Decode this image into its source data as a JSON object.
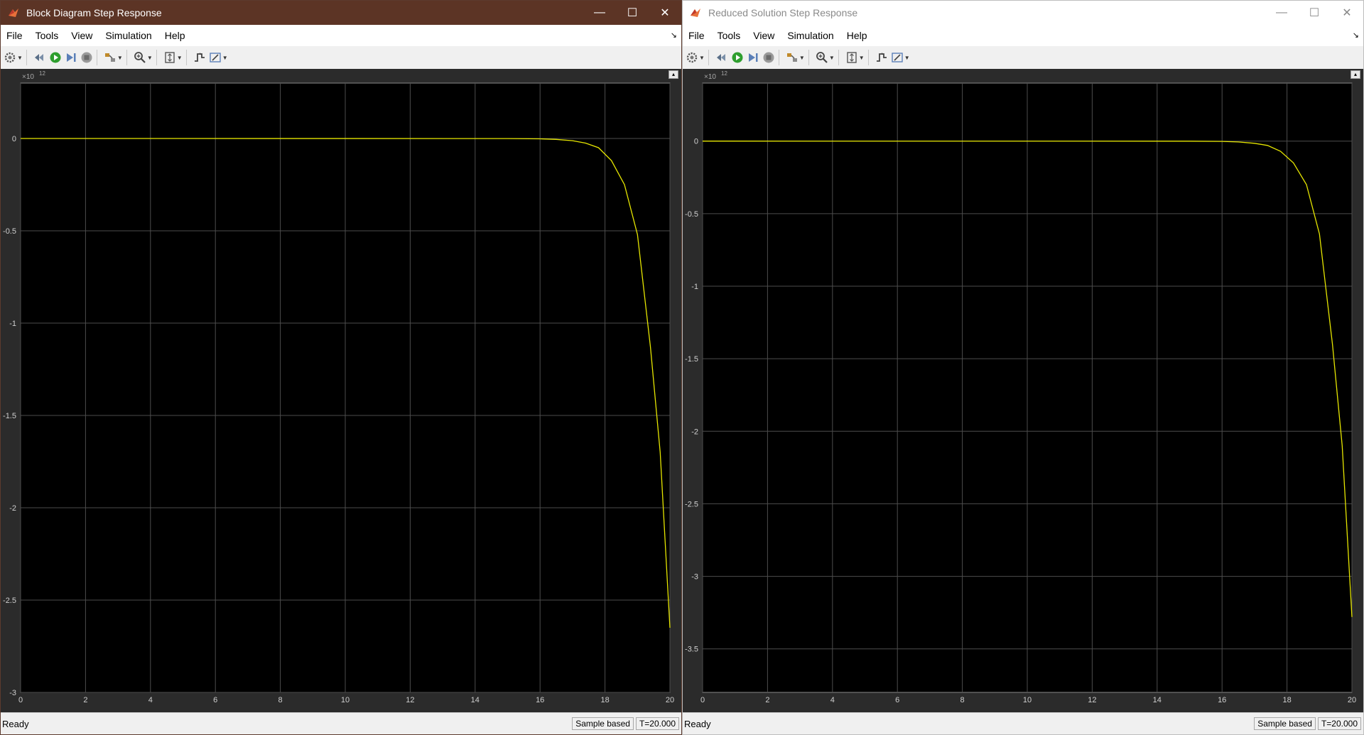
{
  "windows": [
    {
      "title": "Block Diagram Step Response",
      "active": true,
      "menu": [
        "File",
        "Tools",
        "View",
        "Simulation",
        "Help"
      ],
      "status": "Ready",
      "sample_mode": "Sample based",
      "time": "T=20.000",
      "exponent_label": "×10",
      "exponent_power": "12"
    },
    {
      "title": "Reduced Solution Step Response",
      "active": false,
      "menu": [
        "File",
        "Tools",
        "View",
        "Simulation",
        "Help"
      ],
      "status": "Ready",
      "sample_mode": "Sample based",
      "time": "T=20.000",
      "exponent_label": "×10",
      "exponent_power": "12"
    }
  ],
  "toolbar_icons": [
    "settings-icon",
    "restore-icon",
    "run-icon",
    "step-forward-icon",
    "stop-icon",
    "highlight-icon",
    "zoom-icon",
    "scale-axes-icon",
    "triggers-icon",
    "cursor-measurements-icon"
  ],
  "colors": {
    "active_titlebar": "#5c3425",
    "plot_background": "#000000",
    "trace": "#e6e600",
    "grid": "#4d4d4d"
  },
  "chart_data": [
    {
      "type": "line",
      "title": "",
      "xlabel": "",
      "ylabel": "",
      "exponent": "×10^12",
      "xlim": [
        0,
        20
      ],
      "ylim": [
        -3,
        0.3
      ],
      "xticks": [
        0,
        2,
        4,
        6,
        8,
        10,
        12,
        14,
        16,
        18,
        20
      ],
      "yticks": [
        0,
        -0.5,
        -1,
        -1.5,
        -2,
        -2.5,
        -3
      ],
      "ytick_labels": [
        "0",
        "-0.5",
        "-1",
        "-1.5",
        "-2",
        "-2.5",
        "-3"
      ],
      "grid": true,
      "series": [
        {
          "x": [
            0,
            15,
            16,
            16.5,
            17,
            17.4,
            17.8,
            18.2,
            18.6,
            19.0,
            19.4,
            19.7,
            20
          ],
          "y": [
            0,
            -0.0005,
            -0.002,
            -0.005,
            -0.012,
            -0.025,
            -0.05,
            -0.12,
            -0.25,
            -0.52,
            -1.13,
            -1.7,
            -2.65
          ]
        }
      ]
    },
    {
      "type": "line",
      "title": "",
      "xlabel": "",
      "ylabel": "",
      "exponent": "×10^12",
      "xlim": [
        0,
        20
      ],
      "ylim": [
        -3.8,
        0.4
      ],
      "xticks": [
        0,
        2,
        4,
        6,
        8,
        10,
        12,
        14,
        16,
        18,
        20
      ],
      "yticks": [
        0,
        -0.5,
        -1,
        -1.5,
        -2,
        -2.5,
        -3,
        -3.5
      ],
      "ytick_labels": [
        "0",
        "-0.5",
        "-1",
        "-1.5",
        "-2",
        "-2.5",
        "-3",
        "-3.5"
      ],
      "grid": true,
      "series": [
        {
          "x": [
            0,
            15,
            16,
            16.5,
            17,
            17.4,
            17.8,
            18.2,
            18.6,
            19.0,
            19.4,
            19.7,
            20
          ],
          "y": [
            0,
            -0.0005,
            -0.002,
            -0.006,
            -0.015,
            -0.03,
            -0.07,
            -0.15,
            -0.3,
            -0.64,
            -1.4,
            -2.1,
            -3.28
          ]
        }
      ]
    }
  ]
}
